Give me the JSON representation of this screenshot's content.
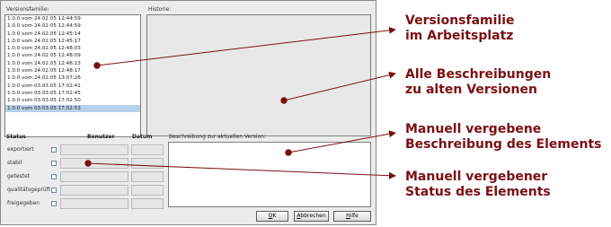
{
  "dialog": {
    "versions_label": "Versionsfamilie:",
    "history_label": "Historie:",
    "versions": [
      "1.0.0 vom 24.02.05 12:44:59",
      "1.0.0 vom 24.02.05 12:44:59",
      "1.0.0 vom 24.02.05 12:45:14",
      "1.0.0 vom 24.02.05 12:45:17",
      "1.0.0 vom 24.02.05 12:48:03",
      "1.0.0 vom 24.02.05 12:48:09",
      "1.0.0 vom 24.02.05 12:48:13",
      "1.0.0 vom 24.02.05 12:48:17",
      "1.0.0 vom 24.02.05 13:07:26",
      "1.0.0 vom 03.03.05 17:02:41",
      "1.0.0 vom 03.03.05 17:02:45",
      "1.0.0 vom 03.03.05 17:02:50",
      "1.0.0 vom 03.03.05 17:02:53"
    ],
    "selected_index": 12,
    "status_header": "Status",
    "user_header": "Benutzer",
    "date_header": "Datum",
    "statuses": [
      "exportiert",
      "stabil",
      "getestet",
      "qualitätsgeprüft",
      "freigegeben"
    ],
    "description_label": "Beschreibung zur aktuellen Version:",
    "buttons": {
      "ok": {
        "mnemonic": "O",
        "rest": "K"
      },
      "cancel": {
        "mnemonic": "A",
        "rest": "bbrechen"
      },
      "help": {
        "mnemonic": "H",
        "rest": "ilfe"
      }
    }
  },
  "annotations": {
    "a1": {
      "line1": "Versionsfamilie",
      "line2": "im Arbeitsplatz"
    },
    "a2": {
      "line1": "Alle Beschreibungen",
      "line2": "zu alten Versionen"
    },
    "a3": {
      "line1": "Manuell vergebene",
      "line2": "Beschreibung des Elements"
    },
    "a4": {
      "line1": "Manuell vergebener",
      "line2": "Status des Elements"
    }
  },
  "colors": {
    "annotation": "#7a0f12",
    "selection": "#b7d1ea"
  }
}
